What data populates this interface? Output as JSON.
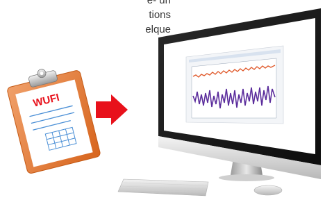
{
  "intro_text": {
    "line1": "e- un",
    "line2": "tions",
    "line3": "elque"
  },
  "clipboard": {
    "title": "WUFI"
  },
  "colors": {
    "arrow": "#e8111b",
    "clipboard": "#e8823a",
    "clipboard_dark": "#d8671f",
    "paper": "#ffffff",
    "ink": "#e8111b",
    "red_series": "#e05a2c",
    "purple_series": "#5b2d9c"
  },
  "icons": {
    "arrow": "right-arrow-icon",
    "clipboard": "clipboard-icon",
    "monitor": "desktop-computer-icon",
    "keyboard": "keyboard-icon",
    "mouse": "mouse-icon"
  }
}
